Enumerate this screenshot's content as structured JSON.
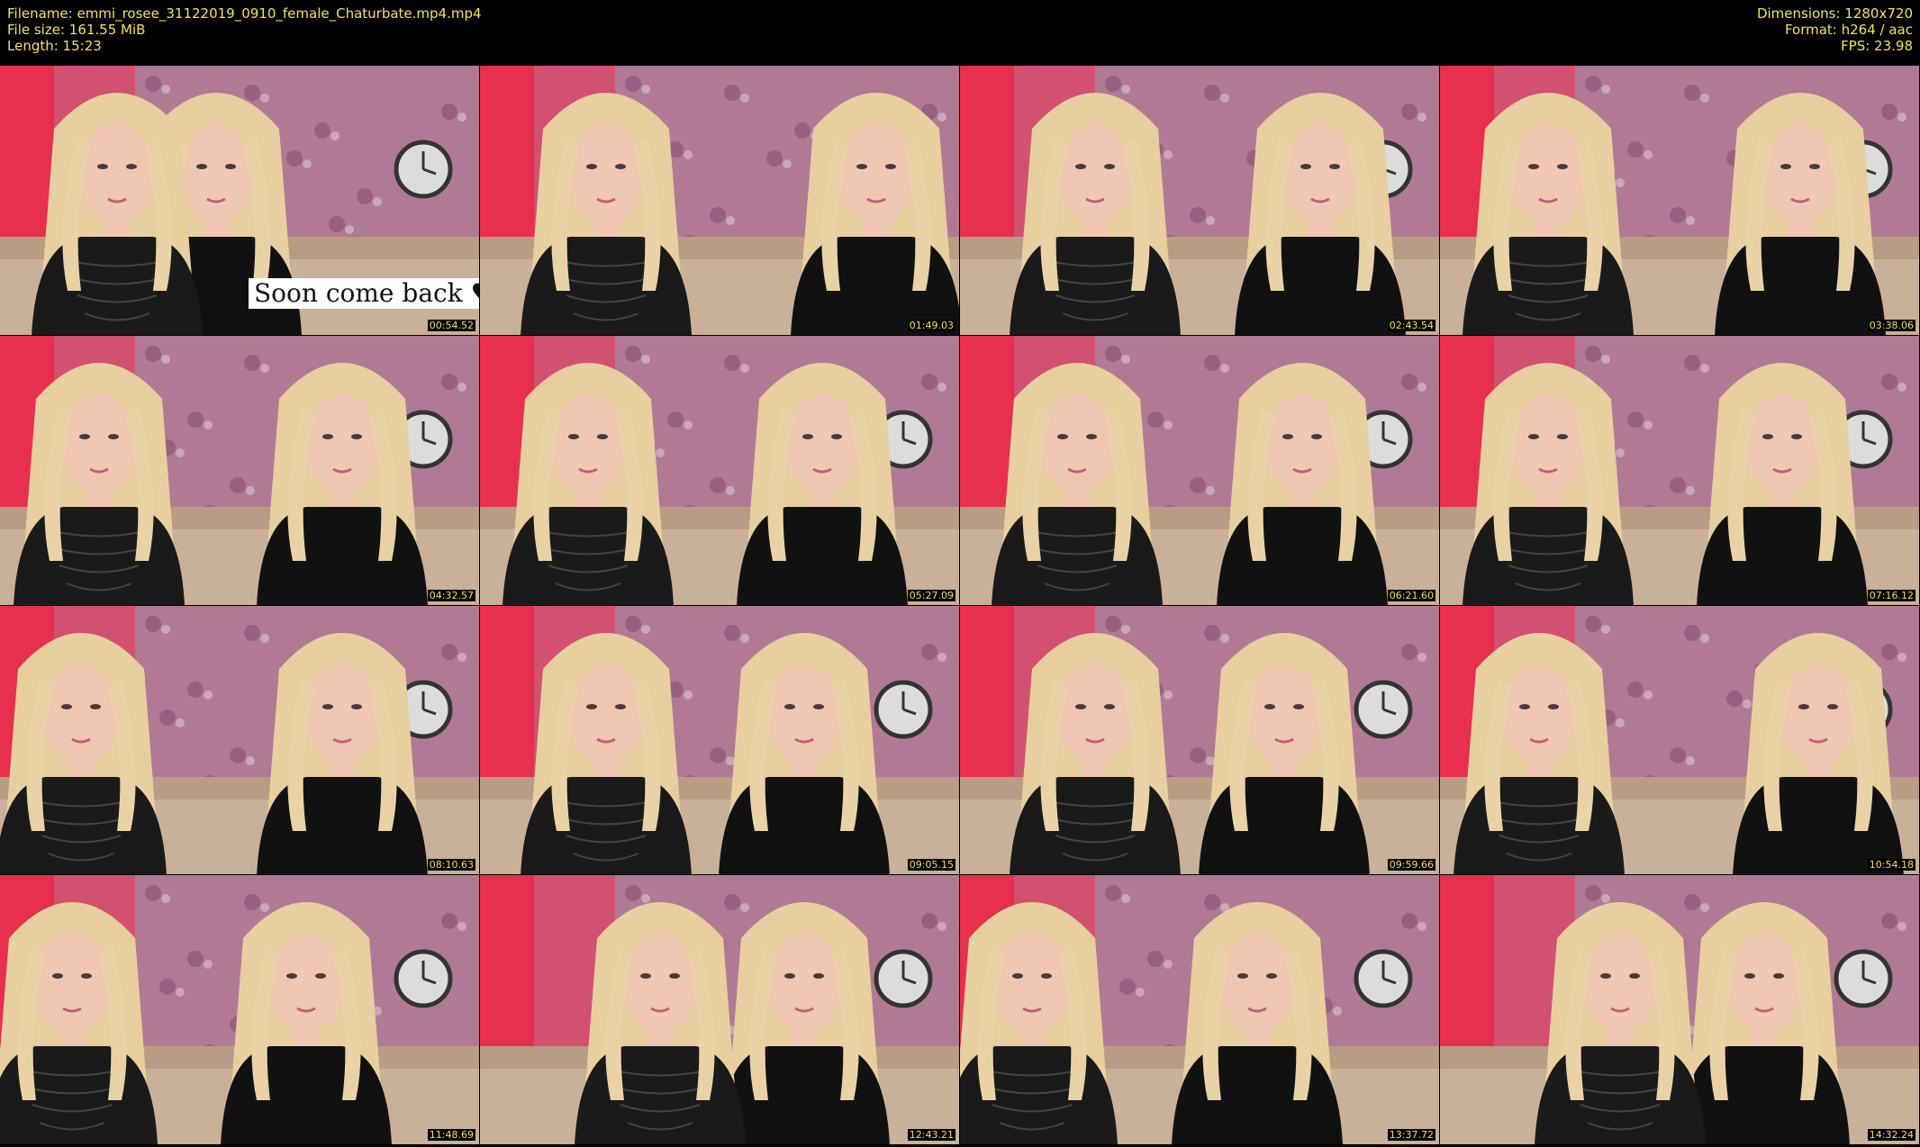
{
  "file_info": {
    "filename_line": "Filename: emmi_rosee_31122019_0910_female_Chaturbate.mp4.mp4",
    "filesize_line": "File size: 161.55 MiB",
    "length_line": "Length: 15:23",
    "dimensions_line": "Dimensions: 1280x720",
    "format_line": "Format: h264 / aac",
    "fps_line": "FPS: 23.98"
  },
  "overlay_caption": "Soon come back ♥",
  "timestamps": [
    "00:54.52",
    "01:49.03",
    "02:43.54",
    "03:38.06",
    "04:32.57",
    "05:27.09",
    "06:21.60",
    "07:16.12",
    "08:10.63",
    "09:05.15",
    "09:59.66",
    "10:54.18",
    "11:48.69",
    "12:43.21",
    "13:37.72",
    "14:32.24"
  ],
  "colors": {
    "background": "#000000",
    "text": "#f2e35a",
    "wall": "#b07a94",
    "accent_red": "#e8304e",
    "couch": "#c9b199",
    "hair": "#e7cf9f",
    "skin": "#f0c7b3",
    "top_black": "#111111"
  }
}
